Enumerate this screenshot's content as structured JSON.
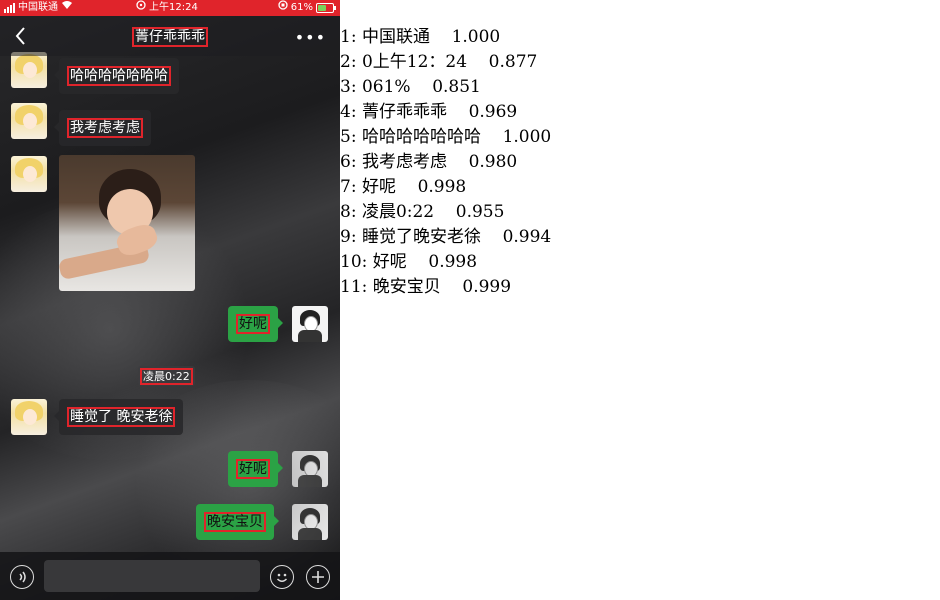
{
  "status_bar": {
    "carrier": "中国联通",
    "time": "上午12:24",
    "battery": "61%",
    "battery_level": 0.61
  },
  "chat": {
    "title": "菁仔乖乖乖",
    "messages": [
      {
        "side": "left",
        "text": "哈哈哈哈哈哈哈"
      },
      {
        "side": "left",
        "text": "我考虑考虑"
      },
      {
        "side": "left",
        "image": "child-photo"
      },
      {
        "side": "right",
        "text": "好呢"
      },
      {
        "timestamp": "凌晨0:22"
      },
      {
        "side": "left",
        "text": "睡觉了 晚安老徐"
      },
      {
        "side": "right",
        "text": "好呢"
      },
      {
        "side": "right",
        "text": "晚安宝贝"
      }
    ]
  },
  "ocr_results": [
    {
      "index": "1:",
      "text": "中国联通",
      "score": "1.000"
    },
    {
      "index": "2:",
      "text": "0上午12：24",
      "score": "0.877"
    },
    {
      "index": "3:",
      "text": "061%",
      "score": "0.851"
    },
    {
      "index": "4:",
      "text": "菁仔乖乖乖",
      "score": "0.969"
    },
    {
      "index": "5:",
      "text": "哈哈哈哈哈哈哈",
      "score": "1.000"
    },
    {
      "index": "6:",
      "text": "我考虑考虑",
      "score": "0.980"
    },
    {
      "index": "7:",
      "text": "好呢",
      "score": "0.998"
    },
    {
      "index": "8:",
      "text": "凌晨0:22",
      "score": "0.955"
    },
    {
      "index": "9:",
      "text": "睡觉了晚安老徐",
      "score": "0.994"
    },
    {
      "index": "10:",
      "text": "好呢",
      "score": "0.998"
    },
    {
      "index": "11:",
      "text": "晚安宝贝",
      "score": "0.999"
    }
  ],
  "colors": {
    "status_bar_red": "#e0242b",
    "bubble_green": "#2ba245",
    "box_red": "#e0242b"
  }
}
